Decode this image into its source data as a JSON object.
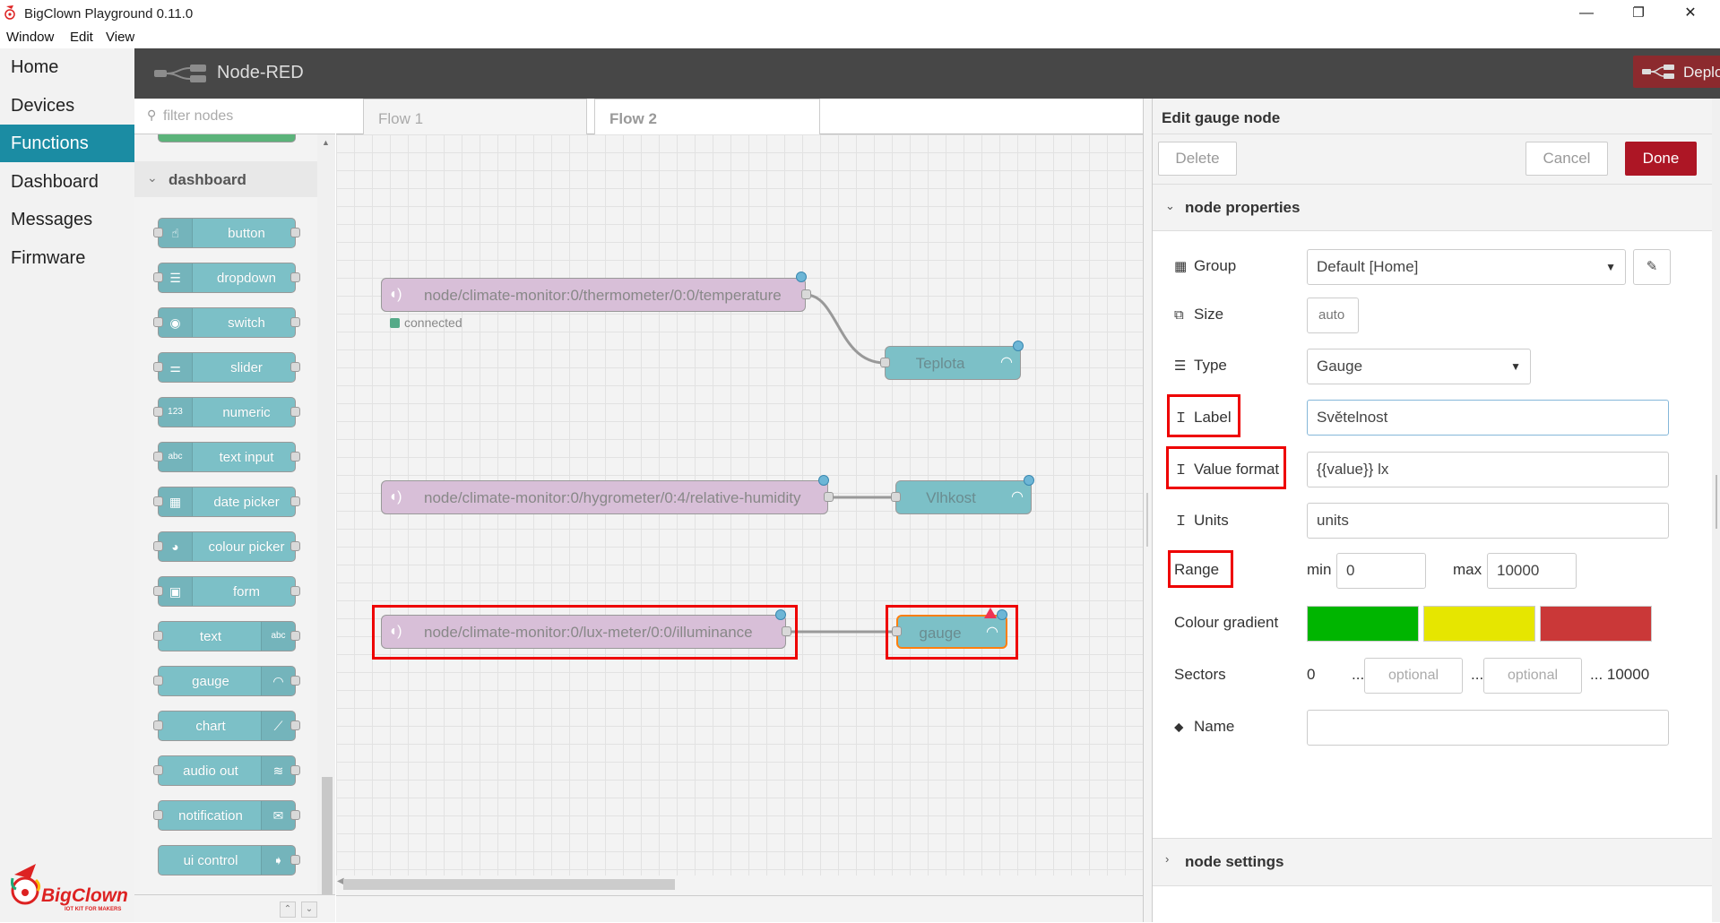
{
  "window": {
    "title": "BigClown Playground 0.11.0",
    "controls": {
      "minimize": "—",
      "restore": "❐",
      "close": "✕"
    }
  },
  "menu": [
    "Window",
    "Edit",
    "View"
  ],
  "app_nav": {
    "items": [
      "Home",
      "Devices",
      "Functions",
      "Dashboard",
      "Messages",
      "Firmware"
    ],
    "active": "Functions",
    "logo_text": "BigClown",
    "logo_tagline": "IOT KIT FOR MAKERS"
  },
  "header": {
    "title": "Node-RED",
    "deploy_label": "Deploy"
  },
  "palette": {
    "filter_placeholder": "filter nodes",
    "category": "dashboard",
    "nodes": [
      {
        "label": "button",
        "icon": "hand-pointer-icon",
        "glyph": "☝"
      },
      {
        "label": "dropdown",
        "icon": "list-icon",
        "glyph": "☰"
      },
      {
        "label": "switch",
        "icon": "toggle-icon",
        "glyph": "◉"
      },
      {
        "label": "slider",
        "icon": "sliders-icon",
        "glyph": "⚌"
      },
      {
        "label": "numeric",
        "icon": "numeric-icon",
        "glyph": "123"
      },
      {
        "label": "text input",
        "icon": "text-input-icon",
        "glyph": "abc"
      },
      {
        "label": "date picker",
        "icon": "calendar-icon",
        "glyph": "▦"
      },
      {
        "label": "colour picker",
        "icon": "palette-icon",
        "glyph": "◕"
      },
      {
        "label": "form",
        "icon": "form-icon",
        "glyph": "▣"
      },
      {
        "label": "text",
        "icon": "text-icon",
        "glyph": "abc"
      },
      {
        "label": "gauge",
        "icon": "gauge-icon",
        "glyph": "◠"
      },
      {
        "label": "chart",
        "icon": "chart-icon",
        "glyph": "⟋"
      },
      {
        "label": "audio out",
        "icon": "audio-icon",
        "glyph": "≋"
      },
      {
        "label": "notification",
        "icon": "envelope-icon",
        "glyph": "✉"
      },
      {
        "label": "ui control",
        "icon": "ui-control-icon",
        "glyph": "➧"
      }
    ]
  },
  "tabs": [
    "Flow 1",
    "Flow 2"
  ],
  "active_tab": "Flow 2",
  "flow": {
    "mqtt_nodes": [
      "node/climate-monitor:0/thermometer/0:0/temperature",
      "node/climate-monitor:0/hygrometer/0:4/relative-humidity",
      "node/climate-monitor:0/lux-meter/0:0/illuminance"
    ],
    "status_text": "connected",
    "ui_nodes": [
      "Teplota",
      "Vlhkost",
      "gauge"
    ]
  },
  "edit_panel": {
    "title": "Edit gauge node",
    "buttons": {
      "delete": "Delete",
      "cancel": "Cancel",
      "done": "Done"
    },
    "sections": {
      "properties": "node properties",
      "settings": "node settings"
    },
    "fields": {
      "group_label": "Group",
      "group_value": "Default [Home]",
      "size_label": "Size",
      "size_value": "auto",
      "type_label": "Type",
      "type_value": "Gauge",
      "label_label": "Label",
      "label_value": "Světelnost",
      "format_label": "Value format",
      "format_value": "{{value}} lx",
      "units_label": "Units",
      "units_value": "units",
      "range_label": "Range",
      "min_label": "min",
      "min_value": "0",
      "max_label": "max",
      "max_value": "10000",
      "gradient_label": "Colour gradient",
      "sectors_label": "Sectors",
      "sectors_start": "0",
      "sectors_placeholder": "optional",
      "sectors_sep": "...",
      "sectors_end": "... 10000",
      "name_label": "Name",
      "name_value": ""
    },
    "gradient_colors": [
      "#00b500",
      "#e6e600",
      "#ca3838"
    ]
  }
}
